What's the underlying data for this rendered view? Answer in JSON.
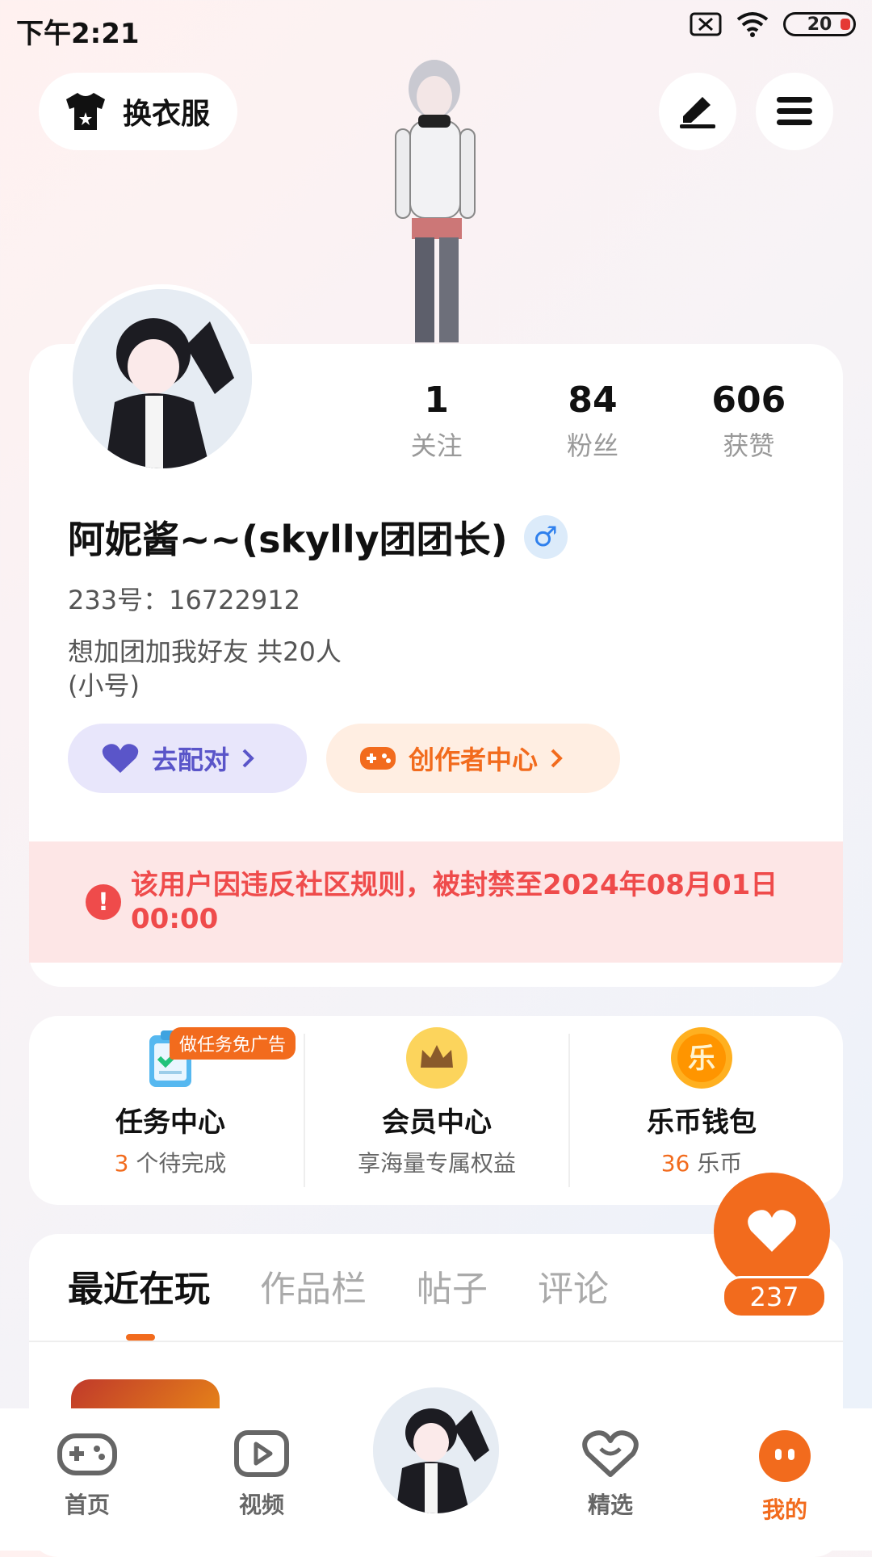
{
  "status_bar": {
    "time": "下午2:21",
    "battery": "20"
  },
  "top": {
    "outfit_label": "换衣服"
  },
  "profile": {
    "stats": [
      {
        "num": "1",
        "label": "关注"
      },
      {
        "num": "84",
        "label": "粉丝"
      },
      {
        "num": "606",
        "label": "获赞"
      }
    ],
    "username": "阿妮酱~~(skylly团团长)",
    "gender_symbol": "♂",
    "uid": "233号：16722912",
    "bio_line1": "想加团加我好友   共20人",
    "bio_line2": "(小号)",
    "match_label": "去配对",
    "creator_label": "创作者中心",
    "ban_notice": "该用户因违反社区规则，被封禁至2024年08月01日 00:00"
  },
  "services": {
    "task_badge": "做任务免广告",
    "items": [
      {
        "title": "任务中心",
        "sub_num": "3",
        "sub_text": " 个待完成"
      },
      {
        "title": "会员中心",
        "sub_num": "",
        "sub_text": "享海量专属权益"
      },
      {
        "title": "乐币钱包",
        "sub_num": "36",
        "sub_text": " 乐币"
      }
    ],
    "wallet_glyph": "乐"
  },
  "tabs": [
    "最近在玩",
    "作品栏",
    "帖子",
    "评论"
  ],
  "like": {
    "count": "237"
  },
  "nav": [
    "首页",
    "视频",
    "精选",
    "我的"
  ],
  "colors": {
    "accent": "#f26b1d",
    "ban_red": "#ef4b4b",
    "match_purple": "#5a55c9"
  }
}
